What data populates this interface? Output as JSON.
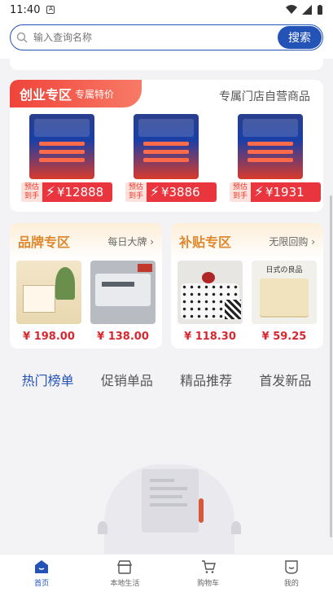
{
  "status_bar": {
    "time": "11:40",
    "notif_letter": "A"
  },
  "search": {
    "placeholder": "输入查询名称",
    "button": "搜索"
  },
  "startup_zone": {
    "title": "创业专区",
    "tag": "专属特价",
    "subtitle": "专属门店自营商品",
    "products": [
      {
        "pre": "预估到手",
        "price": "¥12888"
      },
      {
        "pre": "预估到手",
        "price": "¥3886"
      },
      {
        "pre": "预估到手",
        "price": "¥1931"
      }
    ]
  },
  "brand_zone": {
    "title": "品牌专区",
    "more": "每日大牌",
    "prices": [
      "¥ 198.00",
      "¥ 138.00"
    ]
  },
  "subsidy_zone": {
    "title": "补贴专区",
    "more": "无限回购",
    "prices": [
      "¥ 118.30",
      "¥ 59.25"
    ],
    "towel_label": "日式の良品"
  },
  "tabs": [
    "热门榜单",
    "促销单品",
    "精品推荐",
    "首发新品"
  ],
  "bottom_nav": [
    "首页",
    "本地生活",
    "购物车",
    "我的"
  ],
  "colors": {
    "accent": "#2453b8",
    "price_red": "#d9272e",
    "zone_orange": "#e0882c"
  }
}
